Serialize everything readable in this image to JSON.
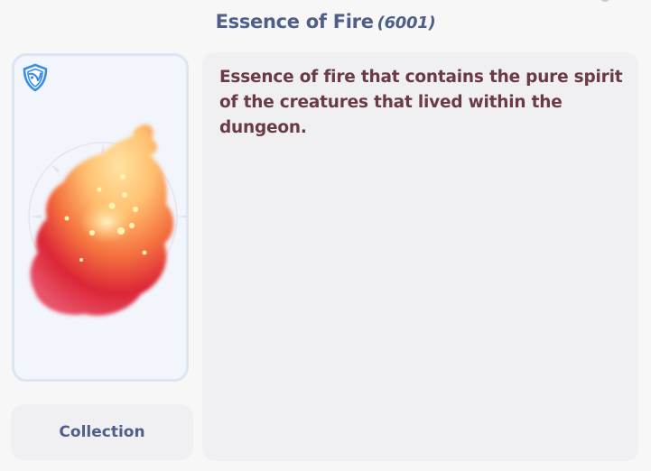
{
  "item": {
    "name": "Essence of Fire",
    "id": "(6001)",
    "description": "Essence of fire that contains the pure spirit of the creatures that lived within the dungeon.",
    "badge_icon": "blue-shield-icon",
    "art_icon": "fire-essence-icon"
  },
  "actions": {
    "collection_label": "Collection"
  },
  "colors": {
    "title": "#4f5f8a",
    "description": "#6b3b45",
    "card_border": "#dce6f2",
    "card_bg": "#f2f5fc",
    "badge": "#3a8ee6"
  }
}
